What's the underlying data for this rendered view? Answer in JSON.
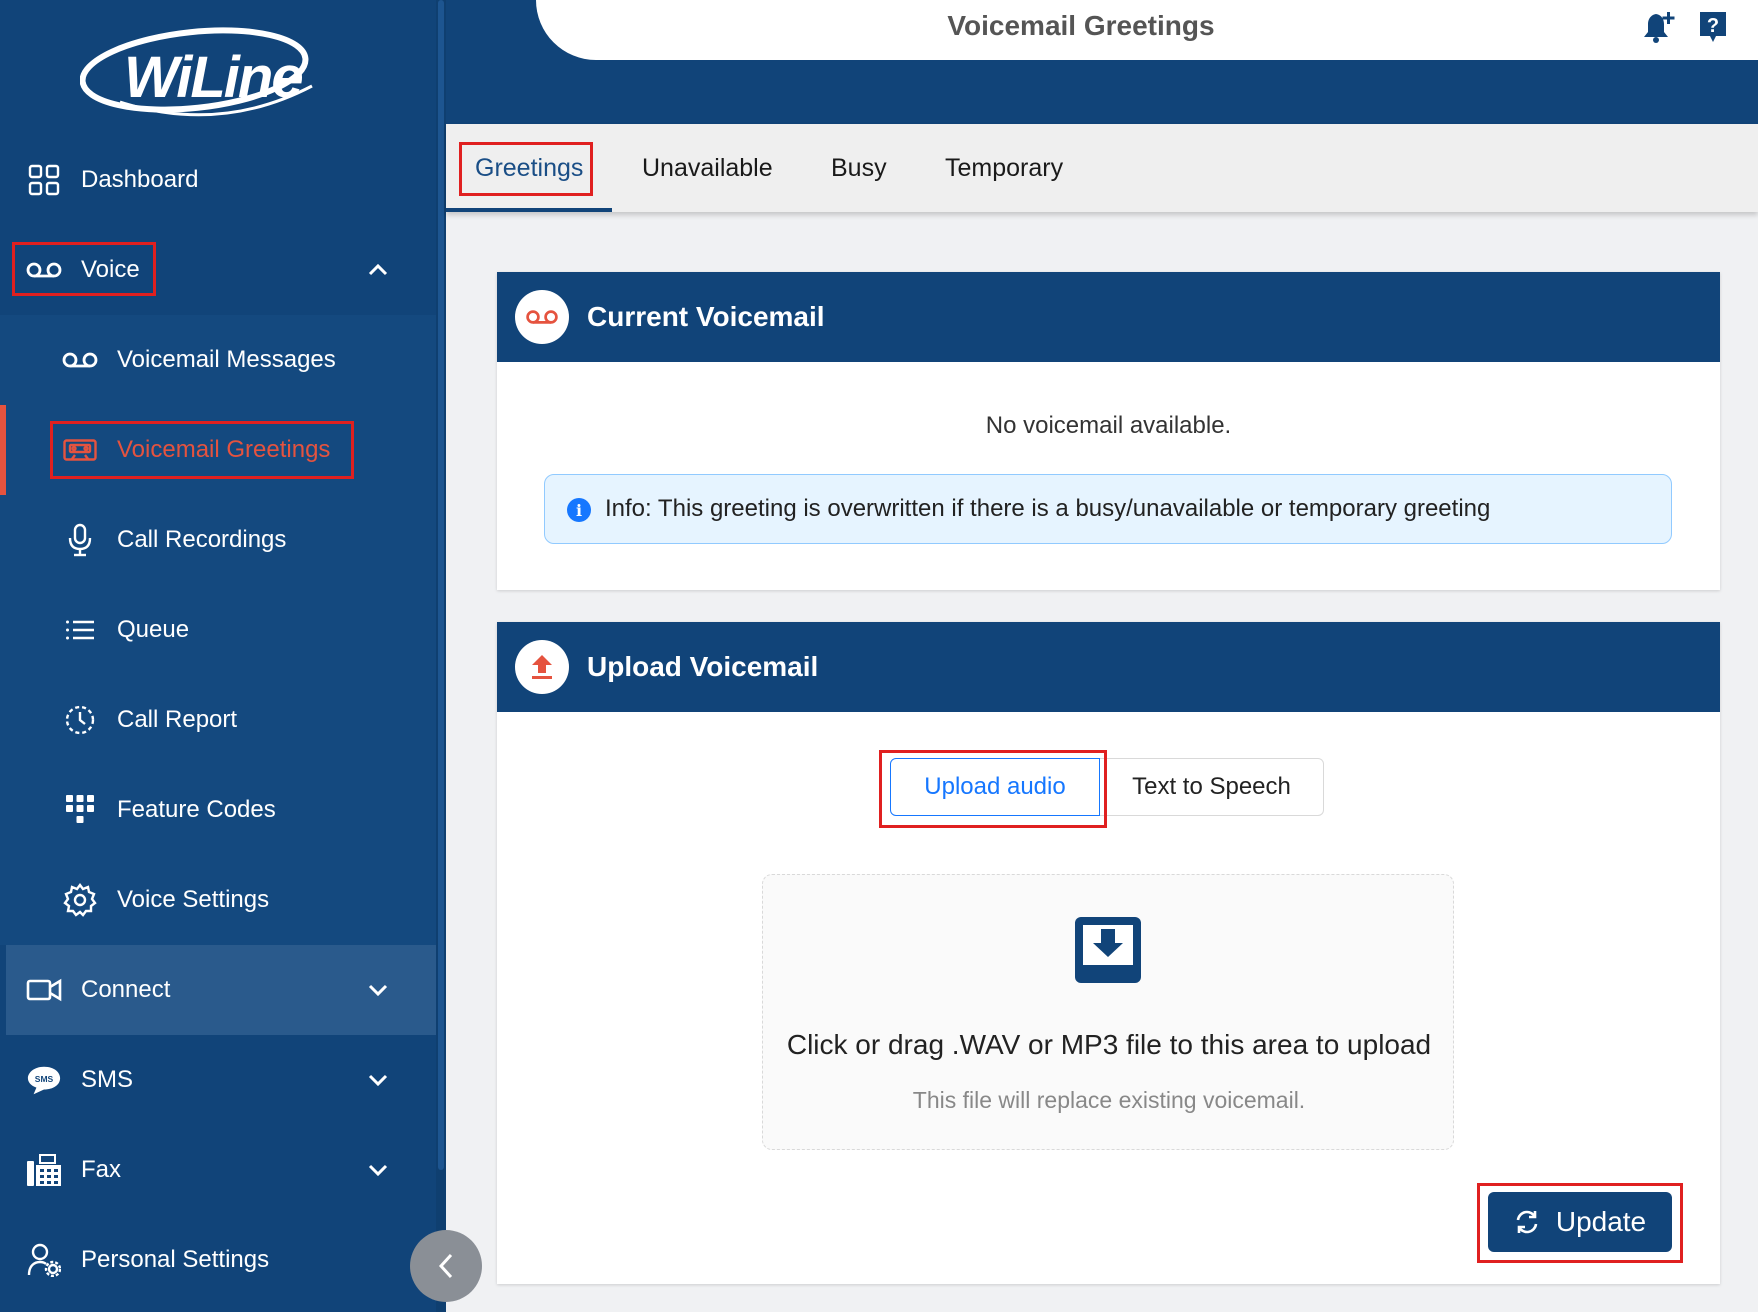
{
  "brand": {
    "logo_text": "WiLine"
  },
  "header": {
    "title": "Voicemail Greetings"
  },
  "sidebar": {
    "items": [
      {
        "label": "Dashboard",
        "icon": "grid-icon"
      },
      {
        "label": "Voice",
        "icon": "voicemail-icon"
      },
      {
        "label": "Voicemail Messages",
        "icon": "voicemail-icon"
      },
      {
        "label": "Voicemail Greetings",
        "icon": "cassette-icon"
      },
      {
        "label": "Call Recordings",
        "icon": "microphone-icon"
      },
      {
        "label": "Queue",
        "icon": "list-icon"
      },
      {
        "label": "Call Report",
        "icon": "history-icon"
      },
      {
        "label": "Feature Codes",
        "icon": "keypad-icon"
      },
      {
        "label": "Voice Settings",
        "icon": "gear-icon"
      },
      {
        "label": "Connect",
        "icon": "video-icon"
      },
      {
        "label": "SMS",
        "icon": "sms-bubble-icon"
      },
      {
        "label": "Fax",
        "icon": "fax-icon"
      },
      {
        "label": "Personal Settings",
        "icon": "user-gear-icon"
      }
    ]
  },
  "tabs": [
    {
      "label": "Greetings"
    },
    {
      "label": "Unavailable"
    },
    {
      "label": "Busy"
    },
    {
      "label": "Temporary"
    }
  ],
  "current_card": {
    "title": "Current Voicemail",
    "empty_text": "No voicemail available.",
    "info_text": "Info: This greeting is overwritten if there is a busy/unavailable or temporary greeting"
  },
  "upload_card": {
    "title": "Upload Voicemail",
    "mode_upload": "Upload audio",
    "mode_tts": "Text to Speech",
    "dropzone_title": "Click or drag .WAV or MP3 file to this area to upload",
    "dropzone_hint": "This file will replace existing voicemail.",
    "update_label": "Update"
  },
  "colors": {
    "primary": "#114479",
    "active": "#e5533f",
    "link": "#1677ff",
    "highlight": "#e02020"
  }
}
